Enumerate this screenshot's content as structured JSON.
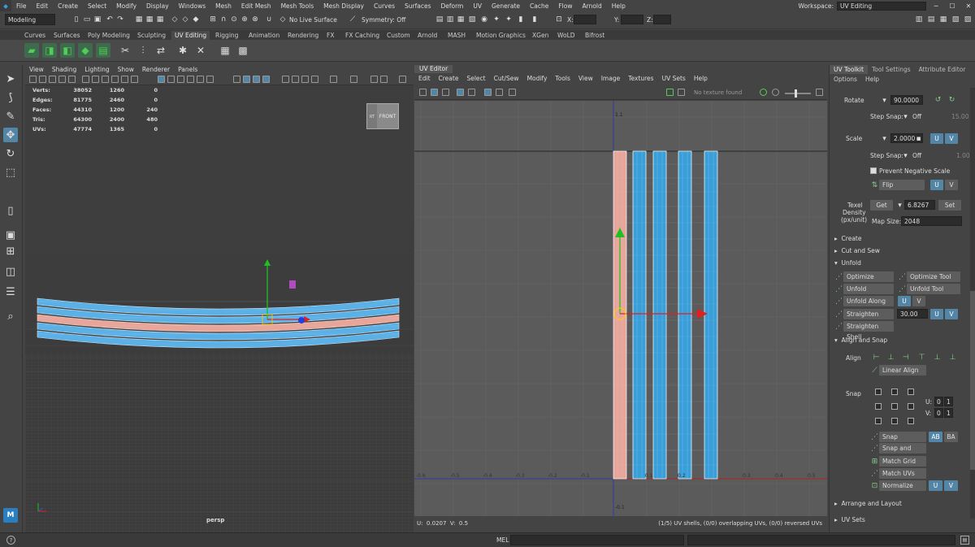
{
  "menubar": {
    "items": [
      "File",
      "Edit",
      "Create",
      "Select",
      "Modify",
      "Display",
      "Windows",
      "Mesh",
      "Edit Mesh",
      "Mesh Tools",
      "Mesh Display",
      "Curves",
      "Surfaces",
      "Deform",
      "UV",
      "Generate",
      "Cache",
      "Flow",
      "Arnold",
      "Help"
    ],
    "workspace_label": "Workspace:",
    "workspace_value": "UV Editing"
  },
  "statusline": {
    "mode": "Modeling",
    "live_surface": "No Live Surface",
    "symmetry": "Symmetry: Off",
    "x_label": "X:",
    "y_label": "Y:",
    "z_label": "Z:"
  },
  "shelf_tabs": [
    "Curves",
    "Surfaces",
    "Poly Modeling",
    "Sculpting",
    "UV Editing",
    "Rigging",
    "Animation",
    "Rendering",
    "FX",
    "FX Caching",
    "Custom",
    "Arnold",
    "MASH",
    "Motion Graphics",
    "XGen",
    "WoLD",
    "Bifrost"
  ],
  "active_shelf": "UV Editing",
  "viewport": {
    "menu": [
      "View",
      "Shading",
      "Lighting",
      "Show",
      "Renderer",
      "Panels"
    ],
    "camera": "persp",
    "cube_top": "RT",
    "cube_front": "FRONT",
    "hud": [
      {
        "label": "Verts:",
        "total": "38052",
        "sel": "1260",
        "comp": "0"
      },
      {
        "label": "Edges:",
        "total": "81775",
        "sel": "2460",
        "comp": "0"
      },
      {
        "label": "Faces:",
        "total": "44310",
        "sel": "1200",
        "comp": "240"
      },
      {
        "label": "Tris:",
        "total": "64300",
        "sel": "2400",
        "comp": "480"
      },
      {
        "label": "UVs:",
        "total": "47774",
        "sel": "1365",
        "comp": "0"
      }
    ]
  },
  "uv_editor": {
    "tab": "UV Editor",
    "menu": [
      "Edit",
      "Create",
      "Select",
      "Cut/Sew",
      "Modify",
      "Tools",
      "View",
      "Image",
      "Textures",
      "UV Sets",
      "Help"
    ],
    "texture_dropdown": "No texture found",
    "axis_labels_bottom": [
      "-0.6",
      "-0.5",
      "-0.4",
      "-0.3",
      "-0.2",
      "-0.1",
      "0.1",
      "0.2",
      "0.3",
      "0.4",
      "0.5",
      "0.6"
    ],
    "axis_label_top": "1.1",
    "axis_label_bottom_v": "-0.1",
    "status_left": "U:  0.0207  V:  0.5",
    "status_right": "(1/5) UV shells, (0/0) overlapping UVs, (0/0) reversed UVs"
  },
  "uv_toolkit": {
    "tabs": [
      "UV Toolkit",
      "Tool Settings",
      "Attribute Editor"
    ],
    "menu": [
      "Options",
      "Help"
    ],
    "rotate_label": "Rotate",
    "rotate_value": "90.0000",
    "step_snap_label": "Step Snap:",
    "step_snap_value": "Off",
    "step_snap_num": "15.00",
    "scale_label": "Scale",
    "scale_value": "2.0000",
    "step_snap2_num": "1.00",
    "u_label": "U",
    "v_label": "V",
    "prevent_negative_scale": "Prevent Negative Scale",
    "flip_label": "Flip",
    "texel_density_label": "Texel\nDensity\n(px/unit)",
    "texel_line1": "Texel",
    "texel_line2": "Density",
    "texel_line3": "(px/unit)",
    "get_label": "Get",
    "texel_value": "6.8267",
    "set_label": "Set",
    "map_size_label": "Map Size:",
    "map_size_value": "2048",
    "sections": [
      "Create",
      "Cut and Sew",
      "Unfold",
      "Align and Snap",
      "Arrange and Layout",
      "UV Sets"
    ],
    "unfold": {
      "optimize": "Optimize",
      "optimize_tool": "Optimize Tool",
      "unfold": "Unfold",
      "unfold_tool": "Unfold Tool",
      "unfold_along": "Unfold Along",
      "straighten_uvs": "Straighten UVs",
      "straighten_value": "30.00",
      "straighten_shell": "Straighten Shell"
    },
    "align_label": "Align",
    "linear_align": "Linear Align",
    "snap_label": "Snap",
    "snap_u_label": "U:",
    "snap_v_label": "V:",
    "snap_u_values": [
      "0",
      "1"
    ],
    "snap_v_values": [
      "0",
      "1"
    ],
    "snap_together": "Snap Together",
    "ab_label": "AB",
    "ba_label": "BA",
    "snap_and_stack": "Snap and Stack",
    "match_grid": "Match Grid",
    "match_uvs": "Match UVs",
    "normalize": "Normalize"
  },
  "helpline": {
    "mel_label": "MEL"
  },
  "colors": {
    "shell_blue": "#3a9fd8",
    "shell_selected": "#e8a599",
    "selection_blue": "#5285a6",
    "axis_red": "#e02020",
    "axis_green": "#20c020"
  }
}
